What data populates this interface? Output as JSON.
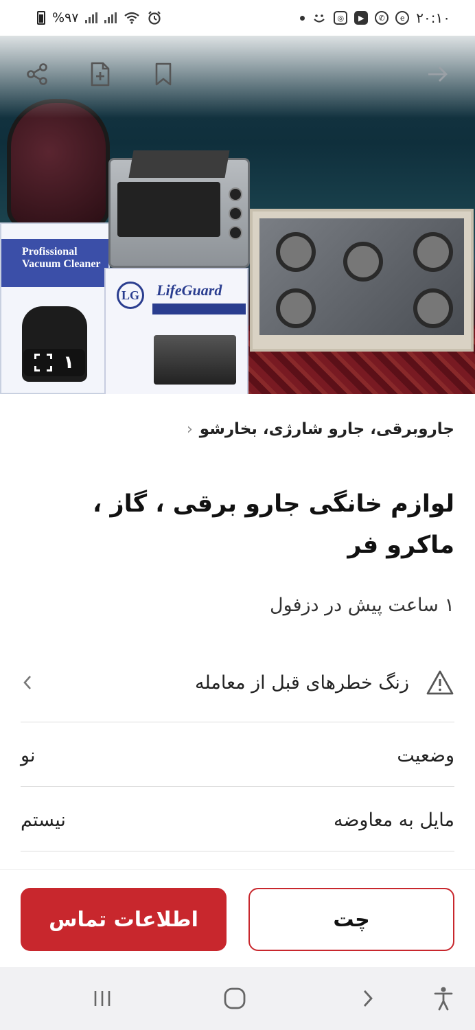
{
  "status_bar": {
    "time": "۲۰:۱۰",
    "battery": "%۹۷"
  },
  "hero": {
    "image_counter": "۱",
    "box_label_vacuum": "Profissional Vacuum Cleaner",
    "box_brand_oven": "LifeGuard",
    "box_logo": "LG"
  },
  "listing": {
    "breadcrumb": "جاروبرقی، جارو شارژی، بخارشو",
    "title": "لوازم خانگی جارو برقی ، گاز ، ماکرو فر",
    "subtitle": "۱ ساعت پیش در دزفول",
    "warning": "زنگ خطرهای قبل از معامله",
    "attributes": [
      {
        "label": "وضعیت",
        "value": "نو"
      },
      {
        "label": "مایل به معاوضه",
        "value": "نیستم"
      }
    ]
  },
  "actions": {
    "contact_label": "اطلاعات تماس",
    "chat_label": "چت",
    "accent_color": "#c8272d"
  },
  "icons": {
    "share": "share-icon",
    "note": "add-note-icon",
    "bookmark": "bookmark-icon",
    "forward": "arrow-forward-icon"
  }
}
